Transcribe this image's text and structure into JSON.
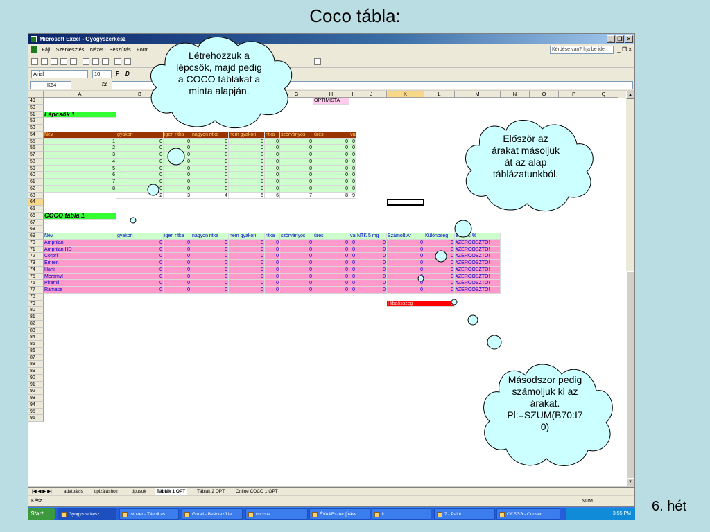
{
  "slide": {
    "title": "Coco tábla:",
    "week": "6. hét"
  },
  "excel": {
    "title": "Microsoft Excel - Gyógyszerkész",
    "menu": [
      "Fájl",
      "Szerkesztés",
      "Nézet",
      "Beszúrás",
      "Form"
    ],
    "help_placeholder": "Kérdése van? Írja be ide.",
    "font_name": "Arial",
    "font_size": "10",
    "name_box": "K64",
    "fx": "fx",
    "columns": [
      "A",
      "B",
      "C",
      "D",
      "E",
      "F",
      "G",
      "H",
      "I",
      "J",
      "K",
      "L",
      "M",
      "N",
      "O",
      "P",
      "Q"
    ],
    "optimista": "OPTIMISTA",
    "lepcsok_title": "Lépcsők 1",
    "coco_title": "COCO tábla 1",
    "headers_lepcsok": [
      "Név",
      "gyakori",
      "igen ritka",
      "nagyon ritka",
      "nem gyakori",
      "ritka",
      "szórványos",
      "üres",
      "van"
    ],
    "headers_coco": [
      "Név",
      "gyakori",
      "igen ritka",
      "nagyon ritka",
      "nem gyakori",
      "ritka",
      "szórványos",
      "üres",
      "van",
      "NTK 5 mg",
      "Számolt Ár",
      "Különbség",
      "Eltérés %"
    ],
    "lepcsok_nums": [
      "1",
      "2",
      "3",
      "4",
      "5",
      "6",
      "7",
      "8"
    ],
    "zero": "0",
    "row63": [
      "2",
      "3",
      "4",
      "5",
      "6",
      "7",
      "8",
      "9"
    ],
    "coco_names": [
      "Amprilan",
      "Amprilan HD",
      "Corpril",
      "Emren",
      "Hartil",
      "Meramyl",
      "Piramil",
      "Ramace"
    ],
    "div_error": "#ZÉRÓOSZTÓ!",
    "hibaosszeg": "Hibaösszeg",
    "hiba_value": "0",
    "sheet_tabs": [
      "adatbázis",
      "tipizáláshoz",
      "tipusok",
      "Táblák 1 OPT",
      "Táblák 2 OPT",
      "Online COCO 1 OPT"
    ],
    "status_left": "Kész",
    "status_num": "NUM"
  },
  "taskbar": {
    "start": "Start",
    "items": [
      "Gyógyszerkész",
      "tstuzer - Távoli as...",
      "Gmail - Beérkező le...",
      "cuccos",
      "ÉVA&Eszter [Írásv...",
      "k",
      "7 - Paint",
      "ОЄБЭЭ - Conver..."
    ],
    "clock": "3:55 PM"
  },
  "callouts": {
    "c1": [
      "Létrehozzuk a",
      "lépcsők, majd pedig",
      "a COCO táblákat a",
      "minta alapján."
    ],
    "c2": [
      "Először az",
      "árakat másoljuk",
      "át az alap",
      "táblázatunkból."
    ],
    "c3": [
      "Másodszor pedig",
      "számoljuk ki az",
      "árakat.",
      "Pl:=SZUM(B70:I7",
      "0)"
    ]
  }
}
